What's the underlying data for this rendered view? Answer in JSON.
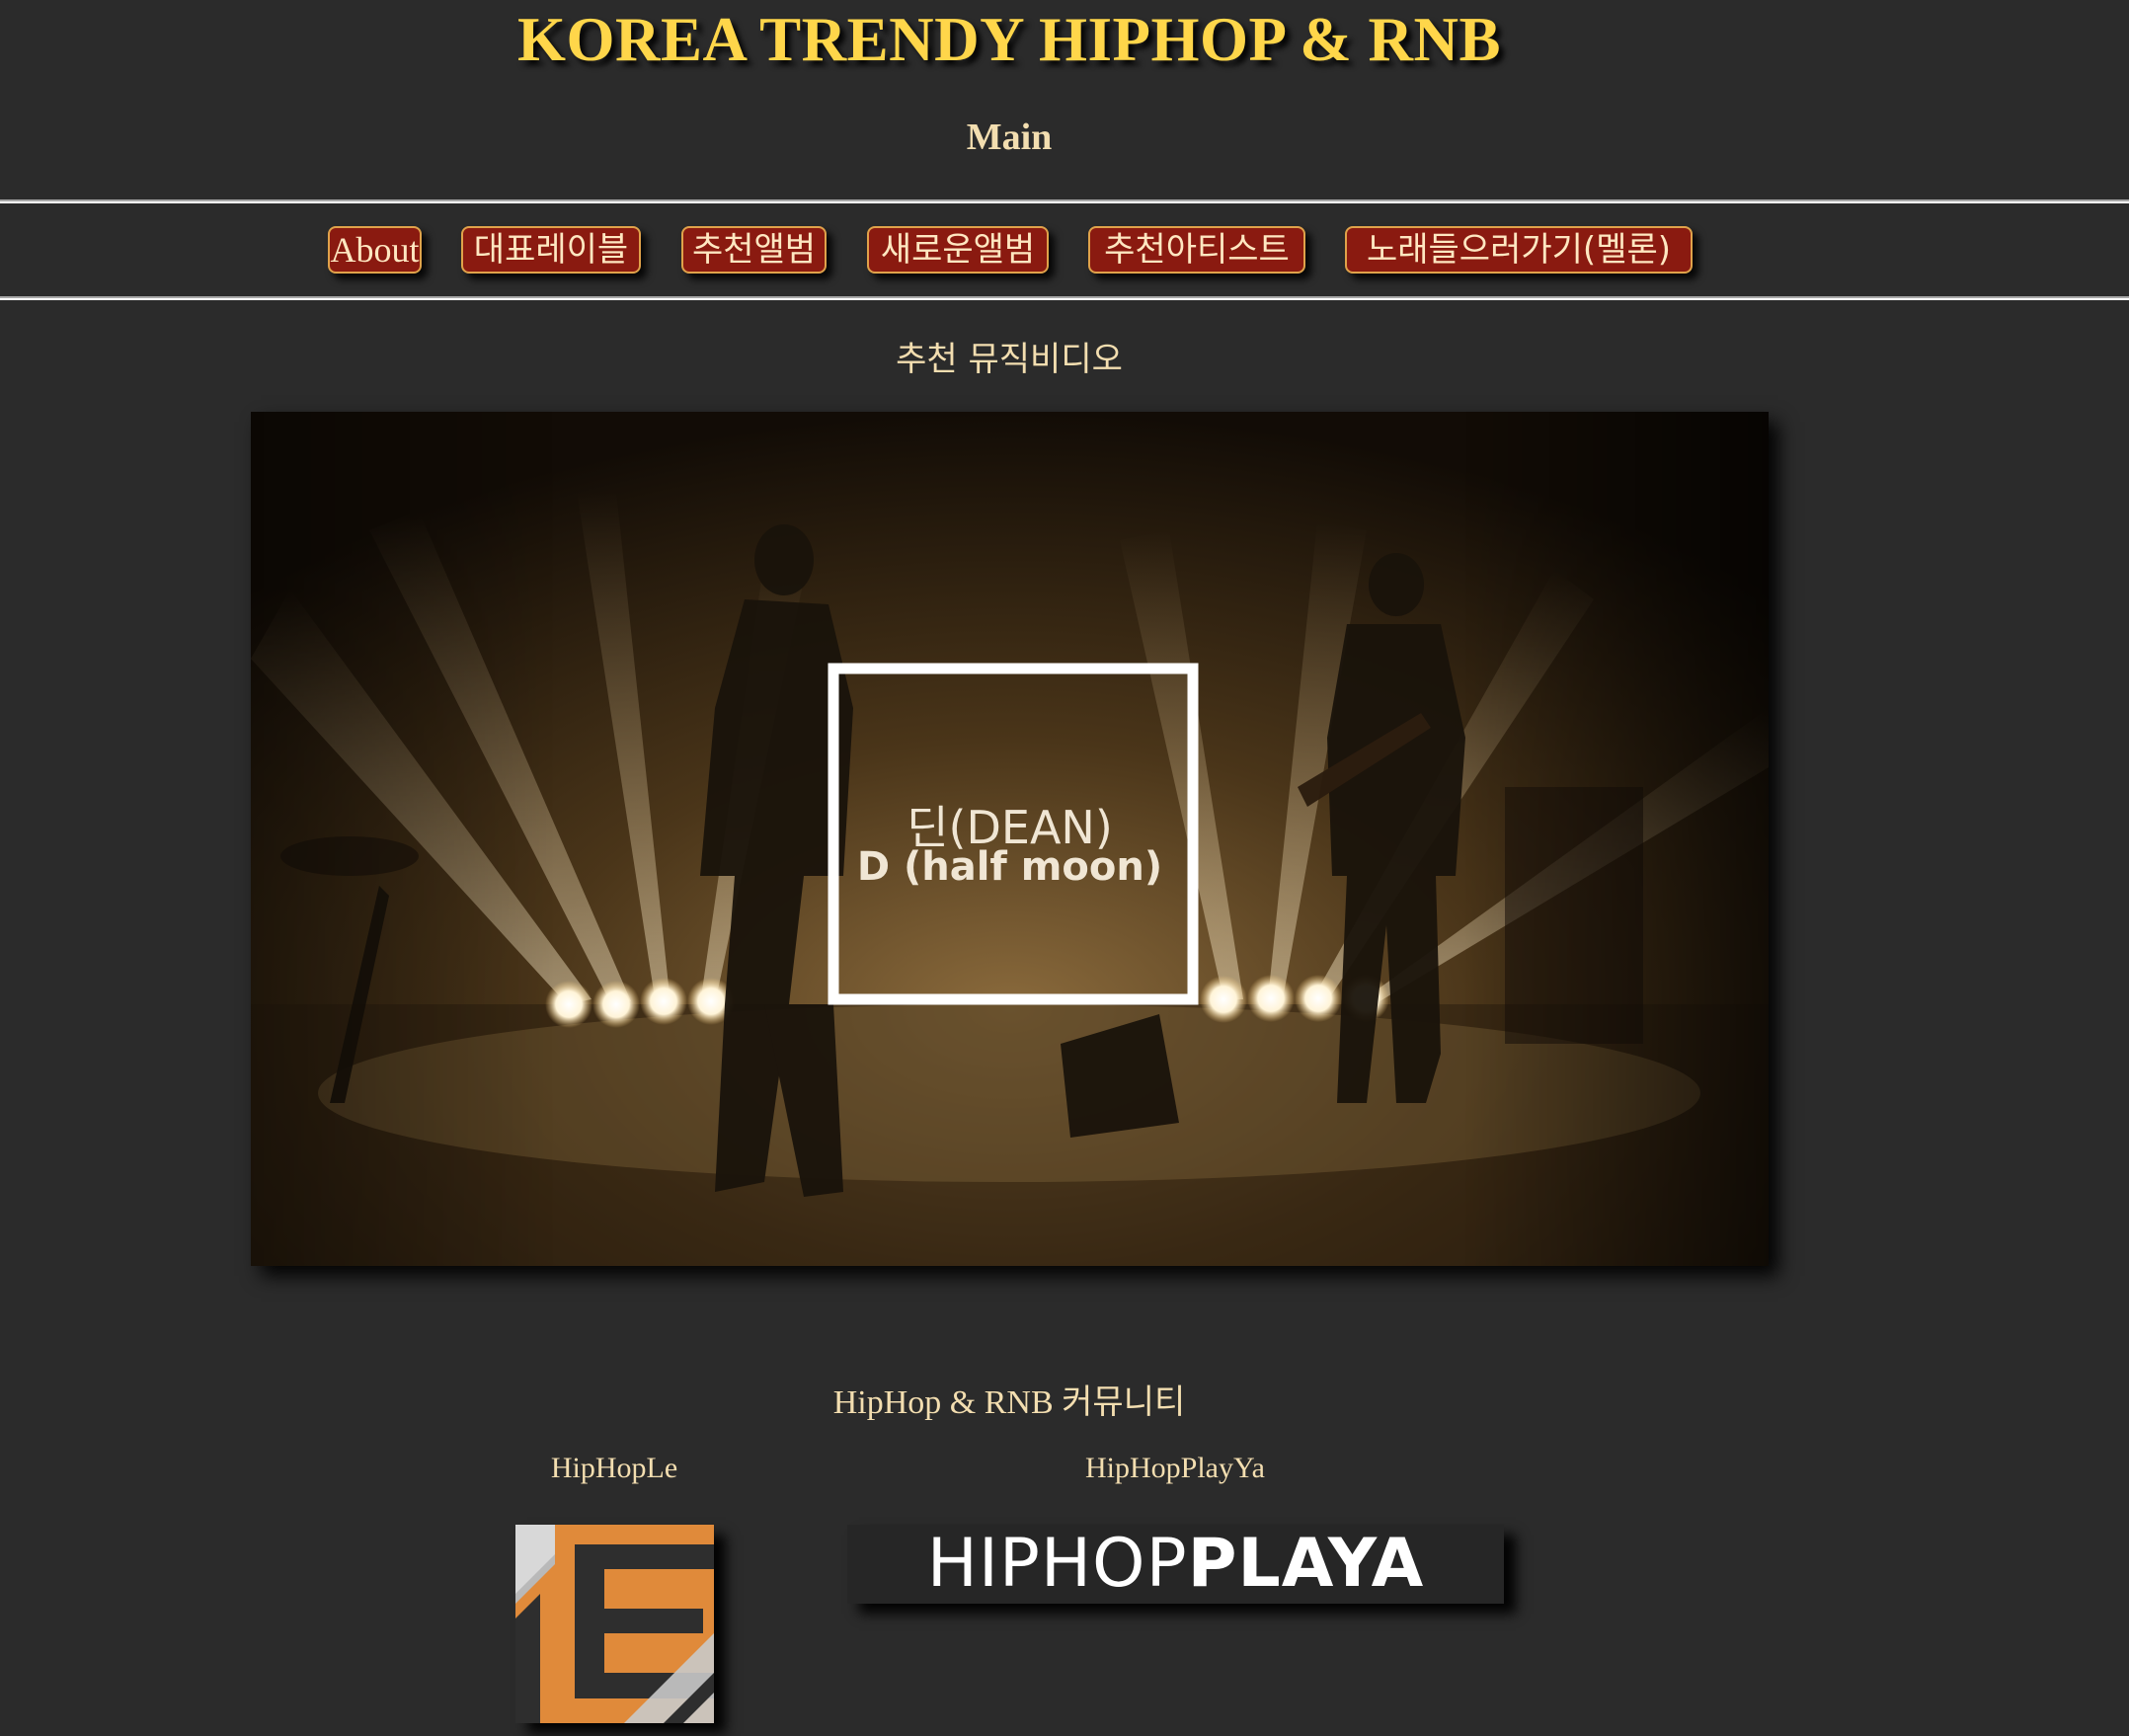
{
  "header": {
    "site_title": "KOREA TRENDY HIPHOP & RNB",
    "page_heading": "Main"
  },
  "nav": {
    "items": [
      {
        "label": "About"
      },
      {
        "label": "대표레이블"
      },
      {
        "label": "추천앨범"
      },
      {
        "label": "새로운앨범"
      },
      {
        "label": "추천아티스트"
      },
      {
        "label": "노래들으러가기(멜론)"
      }
    ]
  },
  "music_video": {
    "section_title": "추천 뮤직비디오",
    "artist": "딘(DEAN)",
    "song": "D (half moon)"
  },
  "community": {
    "section_title": "HipHop & RNB 커뮤니티",
    "sites": [
      {
        "label": "HipHopLe"
      },
      {
        "label": "HipHopPlayYa",
        "logo_text_thin": "HIPHOP",
        "logo_text_bold": "PLAYA"
      }
    ]
  },
  "colors": {
    "background": "#2b2b2b",
    "title": "#ffd64a",
    "text": "#f3deb0",
    "nav_button": "#8a1a10",
    "nav_border": "#e0a24a",
    "logo_orange": "#e08a3a"
  }
}
